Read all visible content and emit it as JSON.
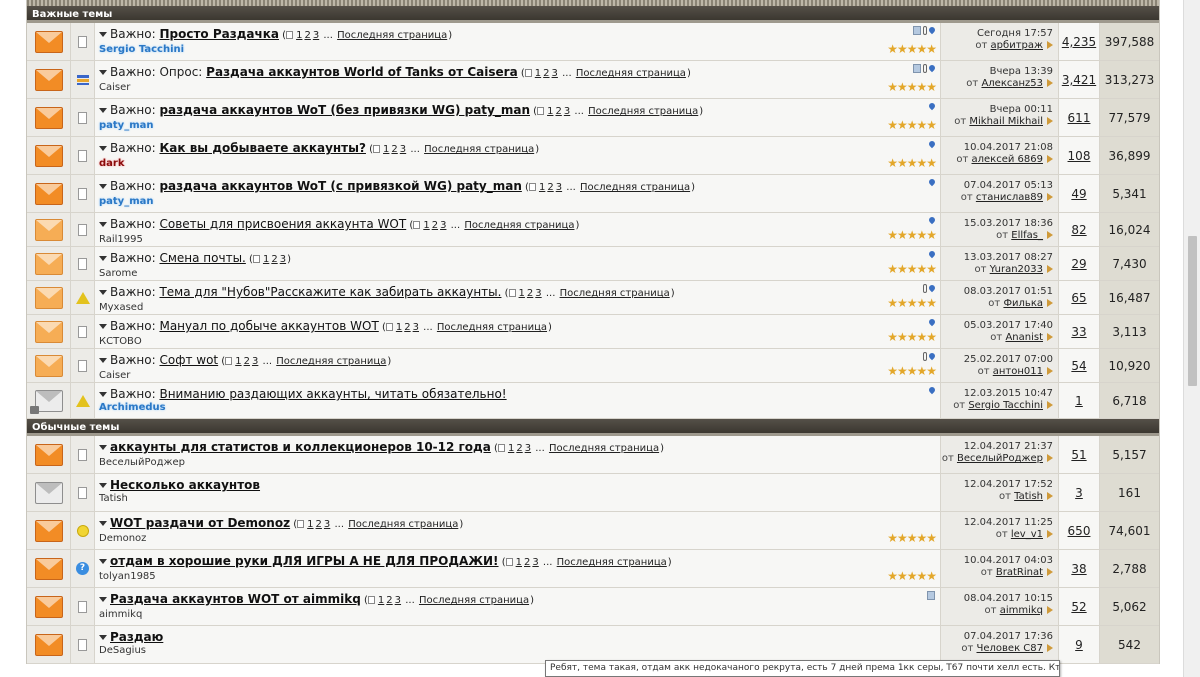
{
  "sections": [
    {
      "title": "Важные темы",
      "threads": [
        {
          "icon": "envelope-new",
          "prefix_icon": "doc",
          "prefix": "Важно:",
          "title": "Просто Раздачка",
          "bold": true,
          "pages": [
            "1",
            "2",
            "3"
          ],
          "last_page_label": "Последняя страница",
          "author": "Sergio Tacchini",
          "author_style": "blue",
          "icons": [
            "att",
            "clip",
            "pin"
          ],
          "stars": "★★★★★",
          "last_date": "Сегодня 17:57",
          "last_by_prefix": "от",
          "last_by": "арбитраж",
          "replies": "4,235",
          "views": "397,588"
        },
        {
          "icon": "envelope-new",
          "prefix_icon": "poll",
          "prefix": "Важно: Опрос:",
          "title": "Раздача аккаунтов World of Tanks от Caisera",
          "bold": true,
          "pages": [
            "1",
            "2",
            "3"
          ],
          "last_page_label": "Последняя страница",
          "author": "Caiser",
          "author_style": "",
          "icons": [
            "att",
            "clip",
            "pin"
          ],
          "stars": "★★★★★",
          "last_date": "Вчера 13:39",
          "last_by_prefix": "от",
          "last_by": "Алексанz53",
          "replies": "3,421",
          "views": "313,273"
        },
        {
          "icon": "envelope-new",
          "prefix_icon": "doc",
          "prefix": "Важно:",
          "title": "раздача аккаунтов WoT (без привязки WG) paty_man",
          "bold": true,
          "pages": [
            "1",
            "2",
            "3"
          ],
          "last_page_label": "Последняя страница",
          "author": "paty_man",
          "author_style": "blue",
          "icons": [
            "pin"
          ],
          "stars": "★★★★★",
          "last_date": "Вчера 00:11",
          "last_by_prefix": "от",
          "last_by": "Mikhail Mikhail",
          "replies": "611",
          "views": "77,579"
        },
        {
          "icon": "envelope-new",
          "prefix_icon": "doc",
          "prefix": "Важно:",
          "title": "Как вы добываете аккаунты?",
          "bold": true,
          "pages": [
            "1",
            "2",
            "3"
          ],
          "last_page_label": "Последняя страница",
          "author": "dark",
          "author_style": "red",
          "icons": [
            "pin"
          ],
          "stars": "★★★★★",
          "last_date": "10.04.2017 21:08",
          "last_by_prefix": "от",
          "last_by": "алексей 6869",
          "replies": "108",
          "views": "36,899"
        },
        {
          "icon": "envelope-new",
          "prefix_icon": "doc",
          "prefix": "Важно:",
          "title": "раздача аккаунтов WoT (с привязкой WG) paty_man",
          "bold": true,
          "pages": [
            "1",
            "2",
            "3"
          ],
          "last_page_label": "Последняя страница",
          "author": "paty_man",
          "author_style": "blue",
          "icons": [
            "pin"
          ],
          "stars": "",
          "last_date": "07.04.2017 05:13",
          "last_by_prefix": "от",
          "last_by": "станислав89",
          "replies": "49",
          "views": "5,341"
        },
        {
          "icon": "envelope-light",
          "prefix_icon": "doc",
          "prefix": "Важно:",
          "title": "Советы для присвоения аккаунта WOT",
          "bold": false,
          "pages": [
            "1",
            "2",
            "3"
          ],
          "last_page_label": "Последняя страница",
          "author": "Rail1995",
          "author_style": "",
          "icons": [
            "pin"
          ],
          "stars": "★★★★★",
          "last_date": "15.03.2017 18:36",
          "last_by_prefix": "от",
          "last_by": "Ellfas_",
          "replies": "82",
          "views": "16,024"
        },
        {
          "icon": "envelope-light",
          "prefix_icon": "doc",
          "prefix": "Важно:",
          "title": "Смена почты.",
          "bold": false,
          "pages": [
            "1",
            "2",
            "3"
          ],
          "last_page_label": "",
          "author": "Sarome",
          "author_style": "",
          "icons": [
            "pin"
          ],
          "stars": "★★★★★",
          "last_date": "13.03.2017 08:27",
          "last_by_prefix": "от",
          "last_by": "Yuran2033",
          "replies": "29",
          "views": "7,430"
        },
        {
          "icon": "envelope-light",
          "prefix_icon": "warn",
          "prefix": "Важно:",
          "title": "Тема для \"Нубов\"Расскажите как забирать аккаунты.",
          "bold": false,
          "pages": [
            "1",
            "2",
            "3"
          ],
          "last_page_label": "Последняя страница",
          "author": "Myxased",
          "author_style": "",
          "icons": [
            "clip",
            "pin"
          ],
          "stars": "★★★★★",
          "last_date": "08.03.2017 01:51",
          "last_by_prefix": "от",
          "last_by": "Филька",
          "replies": "65",
          "views": "16,487"
        },
        {
          "icon": "envelope-light",
          "prefix_icon": "doc",
          "prefix": "Важно:",
          "title": "Мануал по добыче аккаунтов WOT",
          "bold": false,
          "pages": [
            "1",
            "2",
            "3"
          ],
          "last_page_label": "Последняя страница",
          "author": "КСТОВО",
          "author_style": "",
          "icons": [
            "pin"
          ],
          "stars": "★★★★★",
          "last_date": "05.03.2017 17:40",
          "last_by_prefix": "от",
          "last_by": "Ananist",
          "replies": "33",
          "views": "3,113"
        },
        {
          "icon": "envelope-light",
          "prefix_icon": "doc",
          "prefix": "Важно:",
          "title": "Софт wot",
          "bold": false,
          "pages": [
            "1",
            "2",
            "3"
          ],
          "last_page_label": "Последняя страница",
          "author": "Caiser",
          "author_style": "",
          "icons": [
            "clip",
            "pin"
          ],
          "stars": "★★★★★",
          "last_date": "25.02.2017 07:00",
          "last_by_prefix": "от",
          "last_by": "антон011",
          "replies": "54",
          "views": "10,920"
        },
        {
          "icon": "envelope-locked",
          "prefix_icon": "warn",
          "prefix": "Важно:",
          "title": "Вниманию раздающих аккаунты, читать обязательно!",
          "bold": false,
          "pages": [],
          "last_page_label": "",
          "author": "Archimedus",
          "author_style": "blue",
          "icons": [
            "pin"
          ],
          "stars": "",
          "last_date": "12.03.2015 10:47",
          "last_by_prefix": "от",
          "last_by": "Sergio Tacchini",
          "replies": "1",
          "views": "6,718"
        }
      ]
    },
    {
      "title": "Обычные темы",
      "threads": [
        {
          "icon": "envelope-new",
          "prefix_icon": "doc",
          "prefix": "",
          "title": "аккаунты для статистов и коллекционеров 10-12 года",
          "bold": true,
          "pages": [
            "1",
            "2",
            "3"
          ],
          "last_page_label": "Последняя страница",
          "author": "ВеселыйРоджер",
          "author_style": "",
          "icons": [],
          "stars": "",
          "last_date": "12.04.2017 21:37",
          "last_by_prefix": "от",
          "last_by": "ВеселыйРоджер",
          "replies": "51",
          "views": "5,157"
        },
        {
          "icon": "envelope-read",
          "prefix_icon": "doc",
          "prefix": "",
          "title": "Несколько аккаунтов",
          "bold": true,
          "pages": [],
          "last_page_label": "",
          "author": "Tatish",
          "author_style": "",
          "icons": [],
          "stars": "",
          "last_date": "12.04.2017 17:52",
          "last_by_prefix": "от",
          "last_by": "Tatish",
          "replies": "3",
          "views": "161"
        },
        {
          "icon": "envelope-new",
          "prefix_icon": "smile",
          "prefix": "",
          "title": "WOT раздачи от Demonoz",
          "bold": true,
          "pages": [
            "1",
            "2",
            "3"
          ],
          "last_page_label": "Последняя страница",
          "author": "Demonoz",
          "author_style": "",
          "icons": [],
          "stars": "★★★★★",
          "last_date": "12.04.2017 11:25",
          "last_by_prefix": "от",
          "last_by": "lev_v1",
          "replies": "650",
          "views": "74,601"
        },
        {
          "icon": "envelope-new",
          "prefix_icon": "question",
          "prefix": "",
          "title": "отдам в хорошие руки ДЛЯ ИГРЫ А НЕ ДЛЯ ПРОДАЖИ!",
          "bold": true,
          "pages": [
            "1",
            "2",
            "3"
          ],
          "last_page_label": "Последняя страница",
          "author": "tolyan1985",
          "author_style": "",
          "icons": [],
          "stars": "★★★★★",
          "last_date": "10.04.2017 04:03",
          "last_by_prefix": "от",
          "last_by": "BratRinat",
          "replies": "38",
          "views": "2,788"
        },
        {
          "icon": "envelope-new",
          "prefix_icon": "doc",
          "prefix": "",
          "title": "Раздача аккаунтов WOT от aimmikq",
          "bold": true,
          "pages": [
            "1",
            "2",
            "3"
          ],
          "last_page_label": "Последняя страница",
          "author": "aimmikq",
          "author_style": "",
          "icons": [
            "att"
          ],
          "stars": "",
          "last_date": "08.04.2017 10:15",
          "last_by_prefix": "от",
          "last_by": "aimmikq",
          "replies": "52",
          "views": "5,062"
        },
        {
          "icon": "envelope-new",
          "prefix_icon": "doc",
          "prefix": "",
          "title": "Раздаю",
          "bold": true,
          "pages": [],
          "last_page_label": "",
          "author": "DeSagius",
          "author_style": "",
          "icons": [],
          "stars": "",
          "last_date": "07.04.2017 17:36",
          "last_by_prefix": "от",
          "last_by": "Человек С87",
          "replies": "9",
          "views": "542"
        }
      ]
    }
  ],
  "tooltip": "Ребят, тема такая, отдам акк недокачаного рекрута, есть 7 дней према 1кк серы, Т67 почти хелл есть. Кто до качает отблагадарю."
}
